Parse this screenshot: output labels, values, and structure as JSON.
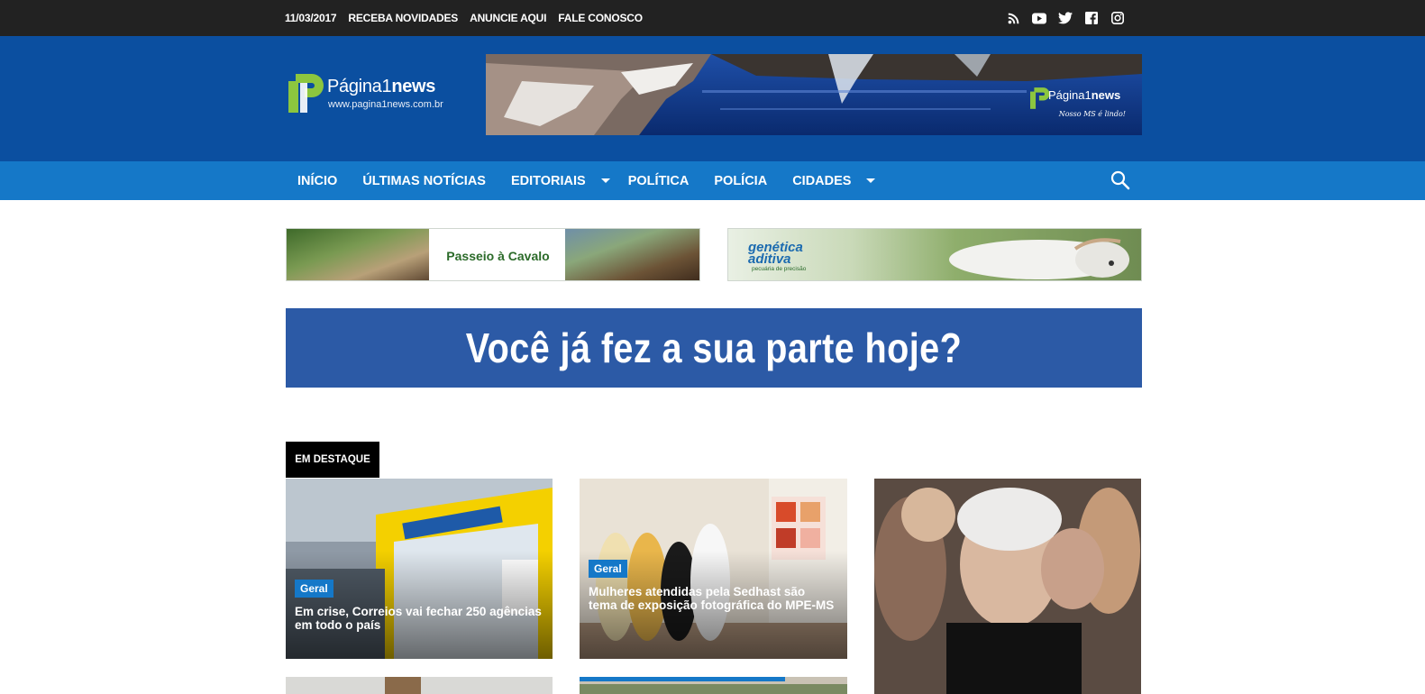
{
  "topbar": {
    "date": "11/03/2017",
    "links": [
      "RECEBA NOVIDADES",
      "ANUNCIE AQUI",
      "FALE CONOSCO"
    ],
    "social_icons": [
      "rss-icon",
      "youtube-icon",
      "twitter-icon",
      "facebook-icon",
      "instagram-icon"
    ]
  },
  "header": {
    "logo_name_light": "Página1",
    "logo_name_bold": "news",
    "logo_url": "www.pagina1news.com.br",
    "banner_logo_light": "Página1",
    "banner_logo_bold": "news",
    "banner_slogan": "Nosso MS é lindo!"
  },
  "nav": {
    "items": [
      {
        "label": "INÍCIO",
        "dropdown": false
      },
      {
        "label": "ÚLTIMAS NOTÍCIAS",
        "dropdown": false
      },
      {
        "label": "EDITORIAIS",
        "dropdown": true
      },
      {
        "label": "POLÍTICA",
        "dropdown": false
      },
      {
        "label": "POLÍCIA",
        "dropdown": false
      },
      {
        "label": "CIDADES",
        "dropdown": true
      }
    ]
  },
  "ads": {
    "cavalo_text": "Passeio à Cavalo",
    "genetica_brand_line1": "genética",
    "genetica_brand_line2": "aditiva",
    "genetica_sub": "pecuária de precisão",
    "wide_banner_text": "Você já fez a sua parte hoje?"
  },
  "featured": {
    "section_label": "EM DESTAQUE",
    "cards": [
      {
        "category": "Geral",
        "title": "Em crise, Correios vai fechar 250 agências em todo o país"
      },
      {
        "category": "Geral",
        "title": "Mulheres atendidas pela Sedhast são tema de exposição fotográfica do MPE-MS"
      }
    ]
  },
  "colors": {
    "topbar": "#222222",
    "header": "#0b4fa0",
    "nav": "#1578c8",
    "wide_banner": "#2c5aa6",
    "category_badge": "#1578c8"
  }
}
